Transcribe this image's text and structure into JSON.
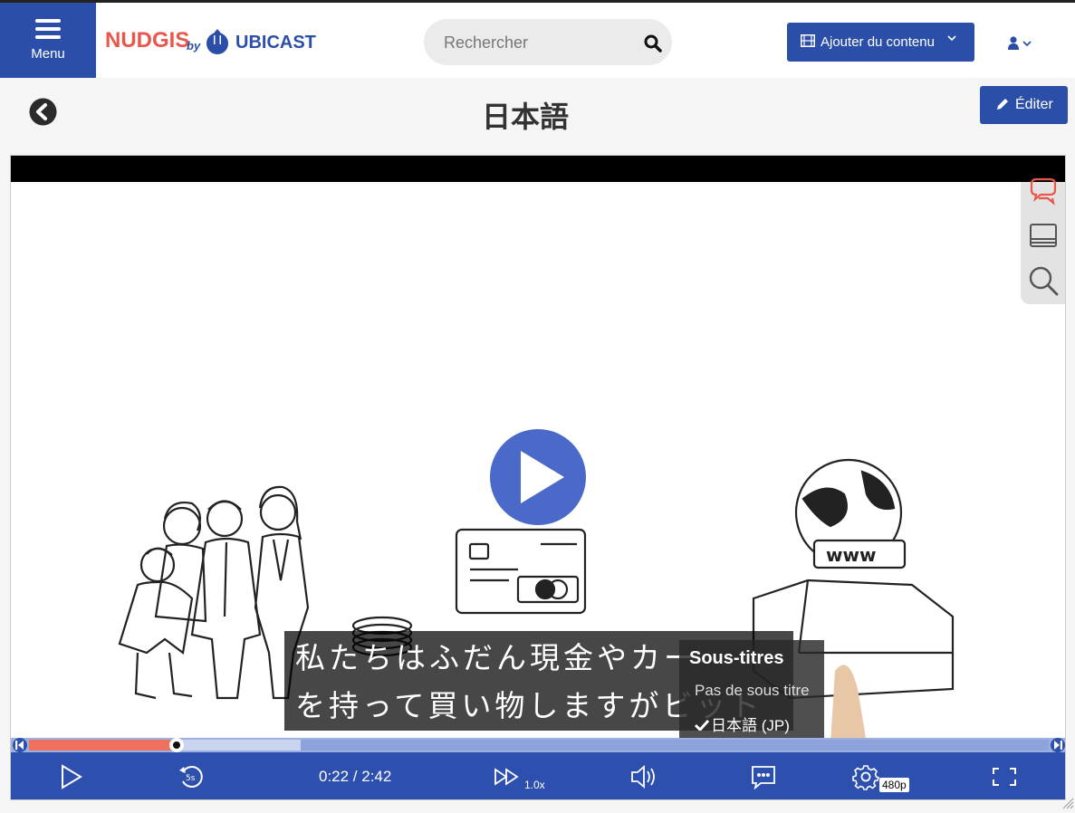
{
  "header": {
    "menu_label": "Menu",
    "logo_nudgis": "NUDGIS",
    "logo_by": "by",
    "logo_ubicast": "UBICAST",
    "search_placeholder": "Rechercher",
    "add_content_label": "Ajouter du contenu"
  },
  "page": {
    "title": "日本語",
    "edit_label": "Éditer"
  },
  "player": {
    "subtitle_lines": [
      "私たちはふだん現金やカー",
      "を持って買い物しますがビット"
    ],
    "subtitles_menu": {
      "title": "Sous-titres",
      "options": [
        "Pas de sous titre",
        "日本語 (JP)"
      ],
      "selected": "日本語 (JP)"
    },
    "timecode": "0:22 / 2:42",
    "current_time": "0:22",
    "duration": "2:42",
    "speed": "1.0x",
    "quality": "480p",
    "progress_fraction": 0.136,
    "buffered_fraction": 0.26
  },
  "colors": {
    "brand_blue": "#2b4fa8",
    "nudgis_red": "#e8574c",
    "progress_played": "#f07060"
  },
  "icons": [
    "menu-icon",
    "search-icon",
    "film-icon",
    "chevron-down-icon",
    "user-icon",
    "back-arrow-icon",
    "pencil-icon",
    "comments-icon",
    "slides-icon",
    "search-icon",
    "play-icon",
    "replay-5s-icon",
    "fast-forward-icon",
    "volume-icon",
    "subtitles-icon",
    "gear-icon",
    "fullscreen-icon",
    "check-icon"
  ]
}
